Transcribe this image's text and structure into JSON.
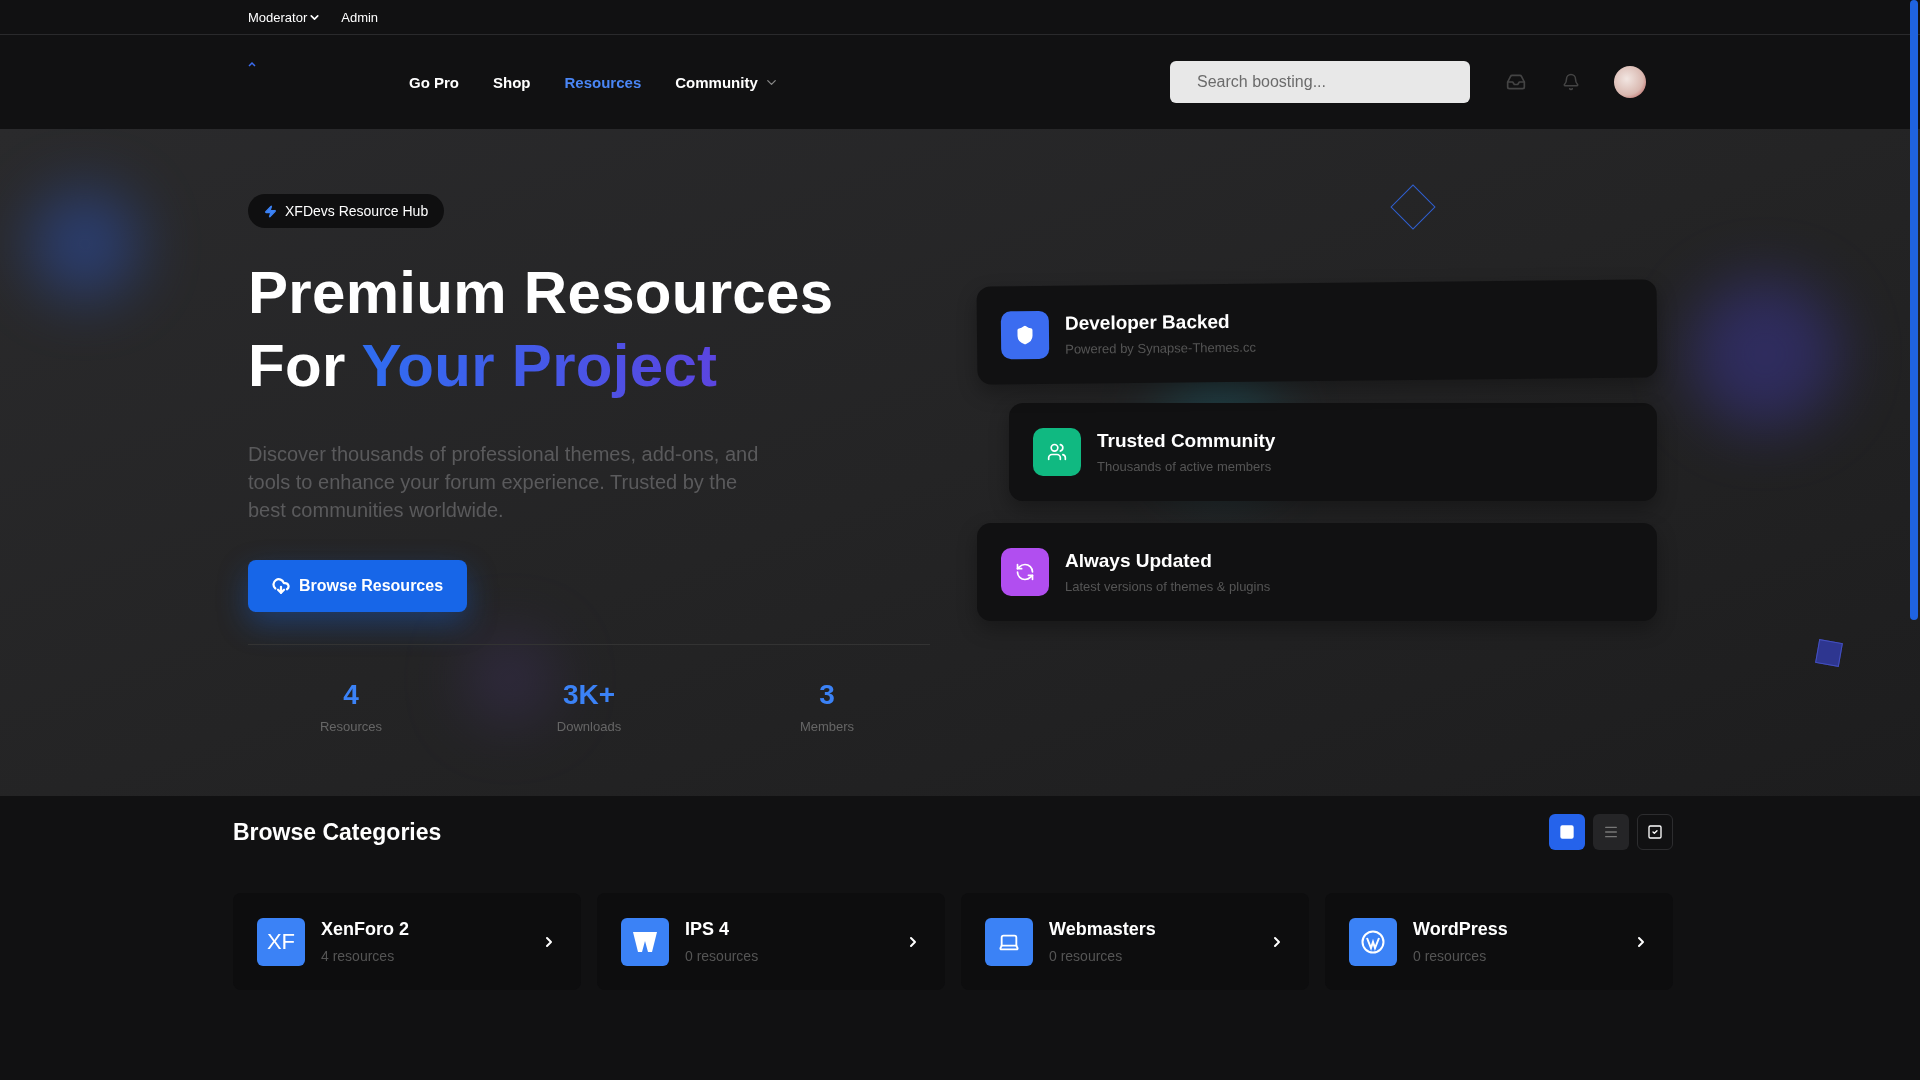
{
  "top_bar": {
    "items": [
      {
        "label": "Moderator",
        "dropdown": true
      },
      {
        "label": "Admin",
        "dropdown": false
      }
    ]
  },
  "nav": {
    "items": [
      {
        "label": "Go Pro",
        "selected": false,
        "dropdown": false
      },
      {
        "label": "Shop",
        "selected": false,
        "dropdown": false
      },
      {
        "label": "Resources",
        "selected": true,
        "dropdown": false
      },
      {
        "label": "Community",
        "selected": false,
        "dropdown": true
      }
    ],
    "search": {
      "placeholder": "Search boosting..."
    }
  },
  "hero": {
    "badge": "XFDevs Resource Hub",
    "heading": {
      "line_1": "Premium Resources",
      "line_2": "For",
      "highlight": "Your Project"
    },
    "description": "Discover thousands of professional themes, add-ons, and tools to enhance your forum experience. Trusted by the best communities worldwide.",
    "button": "Browse Resources",
    "stats": [
      {
        "value": "4",
        "label": "Resources"
      },
      {
        "value": "3K+",
        "label": "Downloads"
      },
      {
        "value": "3",
        "label": "Members"
      }
    ],
    "features": [
      {
        "title": "Developer Backed",
        "subtitle": "Powered by Synapse-Themes.cc",
        "color": "#3b6cf0"
      },
      {
        "title": "Trusted Community",
        "subtitle": "Thousands of active members",
        "color": "#10b981"
      },
      {
        "title": "Always Updated",
        "subtitle": "Latest versions of themes & plugins",
        "color": "#b14ef0"
      }
    ]
  },
  "categories": {
    "title": "Browse Categories",
    "views": [
      {
        "selected": true
      },
      {
        "selected": false
      },
      {
        "selected": false
      }
    ],
    "items": [
      {
        "name": "XenForo 2",
        "count": "4 resources",
        "icon_text": "XF"
      },
      {
        "name": "IPS 4",
        "count": "0 resources"
      },
      {
        "name": "Webmasters",
        "count": "0 resources"
      },
      {
        "name": "WordPress",
        "count": "0 resources"
      }
    ]
  }
}
